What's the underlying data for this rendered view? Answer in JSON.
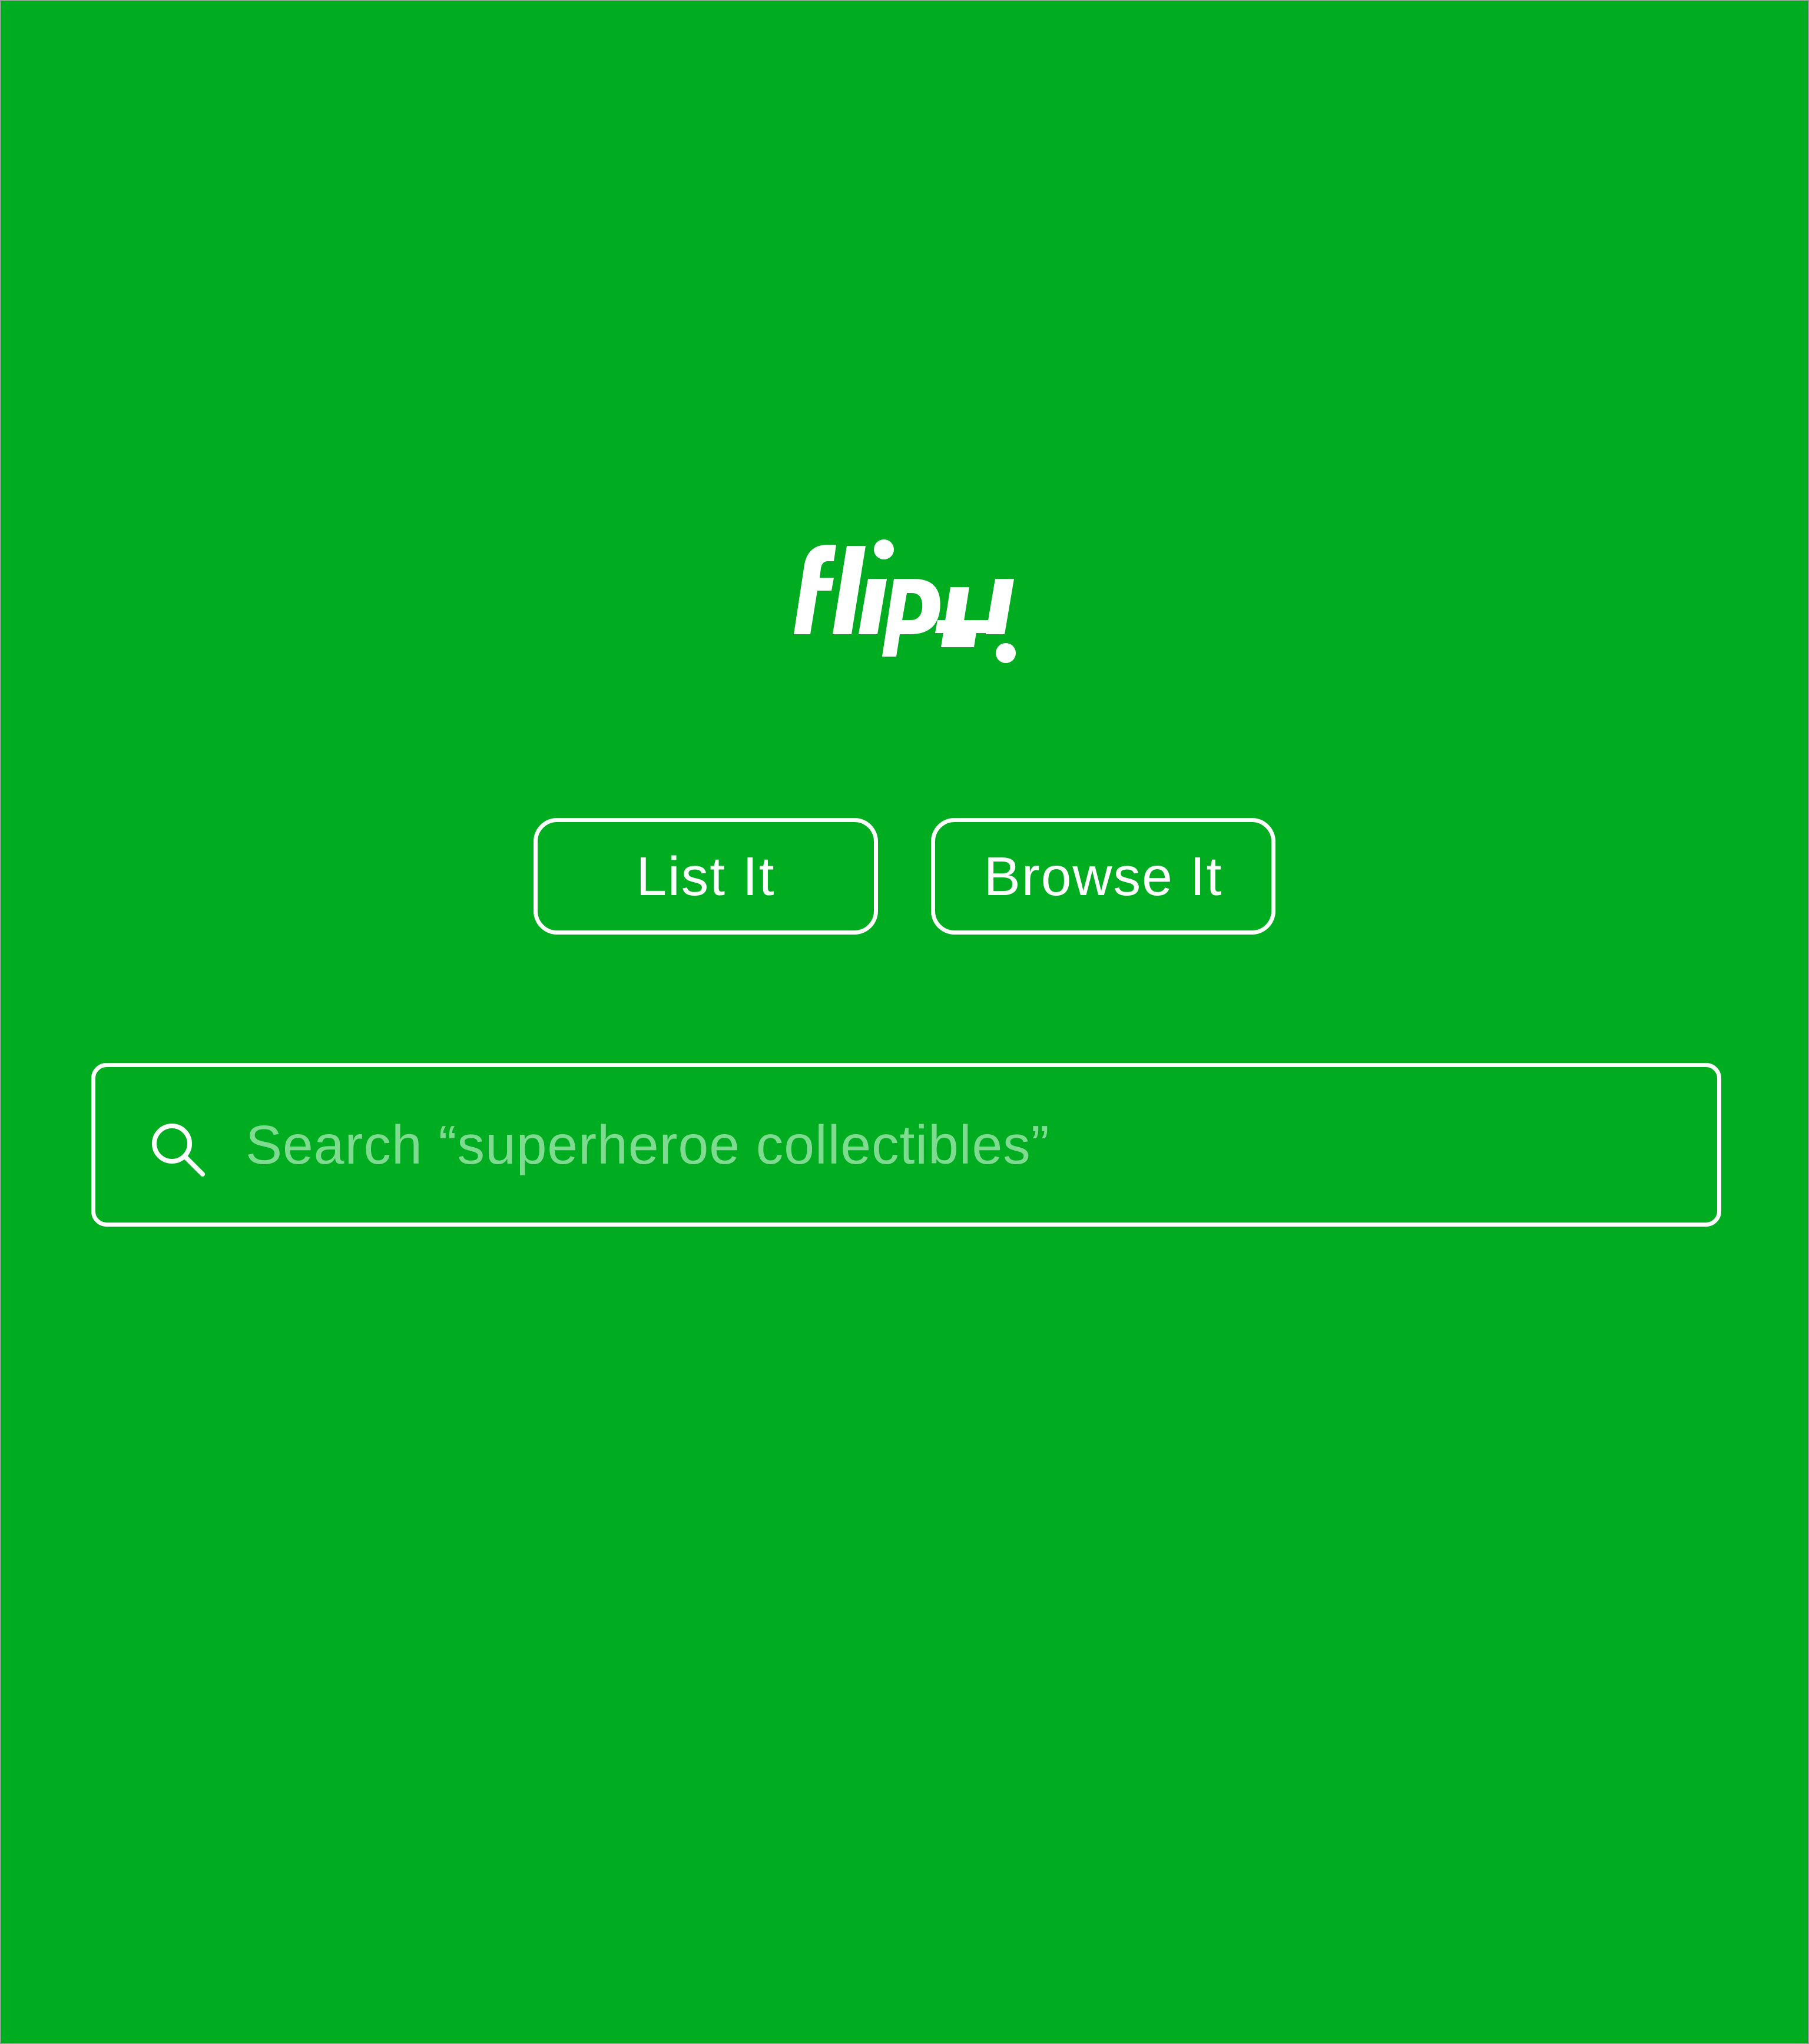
{
  "app": {
    "logo_text": "flipit",
    "background_color": "#00ad20",
    "foreground_color": "#ffffff",
    "placeholder_color": "#7fdb8f"
  },
  "actions": {
    "list_label": "List It",
    "browse_label": "Browse It"
  },
  "search": {
    "icon": "search-icon",
    "value": "",
    "placeholder": "Search “superheroe collectibles”"
  }
}
